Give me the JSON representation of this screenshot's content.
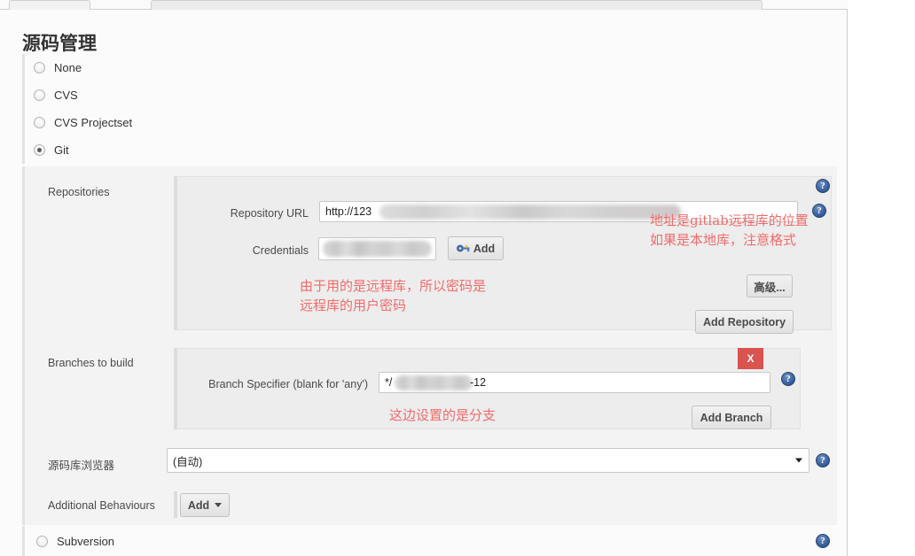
{
  "window": {
    "tabs": [
      {
        "name": "tab-left-fragment",
        "label": ""
      },
      {
        "name": "tab-right-fragment",
        "label": ""
      }
    ]
  },
  "page_title": "源码管理",
  "scm_options": [
    {
      "label": "None",
      "selected": false
    },
    {
      "label": "CVS",
      "selected": false
    },
    {
      "label": "CVS Projectset",
      "selected": false
    },
    {
      "label": "Git",
      "selected": true
    },
    {
      "label": "Subversion",
      "selected": false
    }
  ],
  "git": {
    "repositories": {
      "section_label": "Repositories",
      "repository_url": {
        "label": "Repository URL",
        "value": "http://123",
        "placeholder": ""
      },
      "credentials": {
        "label": "Credentials",
        "value": "*****",
        "add_button": "Add",
        "add_icon": "key-icon"
      },
      "advanced_button": "高级...",
      "add_repository_button": "Add Repository"
    },
    "branches": {
      "section_label": "Branches to build",
      "branch_specifier": {
        "label": "Branch Specifier (blank for 'any')",
        "value": "*/",
        "value_suffix": "-12"
      },
      "delete_button": "X",
      "add_branch_button": "Add Branch"
    },
    "repository_browser": {
      "label": "源码库浏览器",
      "value": "(自动)",
      "options": [
        "(自动)"
      ]
    },
    "additional_behaviours": {
      "label": "Additional Behaviours",
      "add_button": "Add"
    }
  },
  "annotations": [
    {
      "name": "annotation-url",
      "text": "地址是gitlab远程库的位置\n如果是本地库，注意格式",
      "color": "#f26b6b"
    },
    {
      "name": "annotation-credentials",
      "text": "由于用的是远程库，所以密码是\n远程库的用户密码",
      "color": "#f26b6b"
    },
    {
      "name": "annotation-branch",
      "text": "这边设置的是分支",
      "color": "#f26b6b"
    }
  ],
  "help_icon_glyph": "?",
  "colors": {
    "accent_red": "#d9534f",
    "annotation_red": "#f26b6b",
    "help_blue": "#3a62a0",
    "panel_bg": "#f3f3f3",
    "inner_panel_bg": "#ededed",
    "page_bg": "#fbfbfb"
  }
}
